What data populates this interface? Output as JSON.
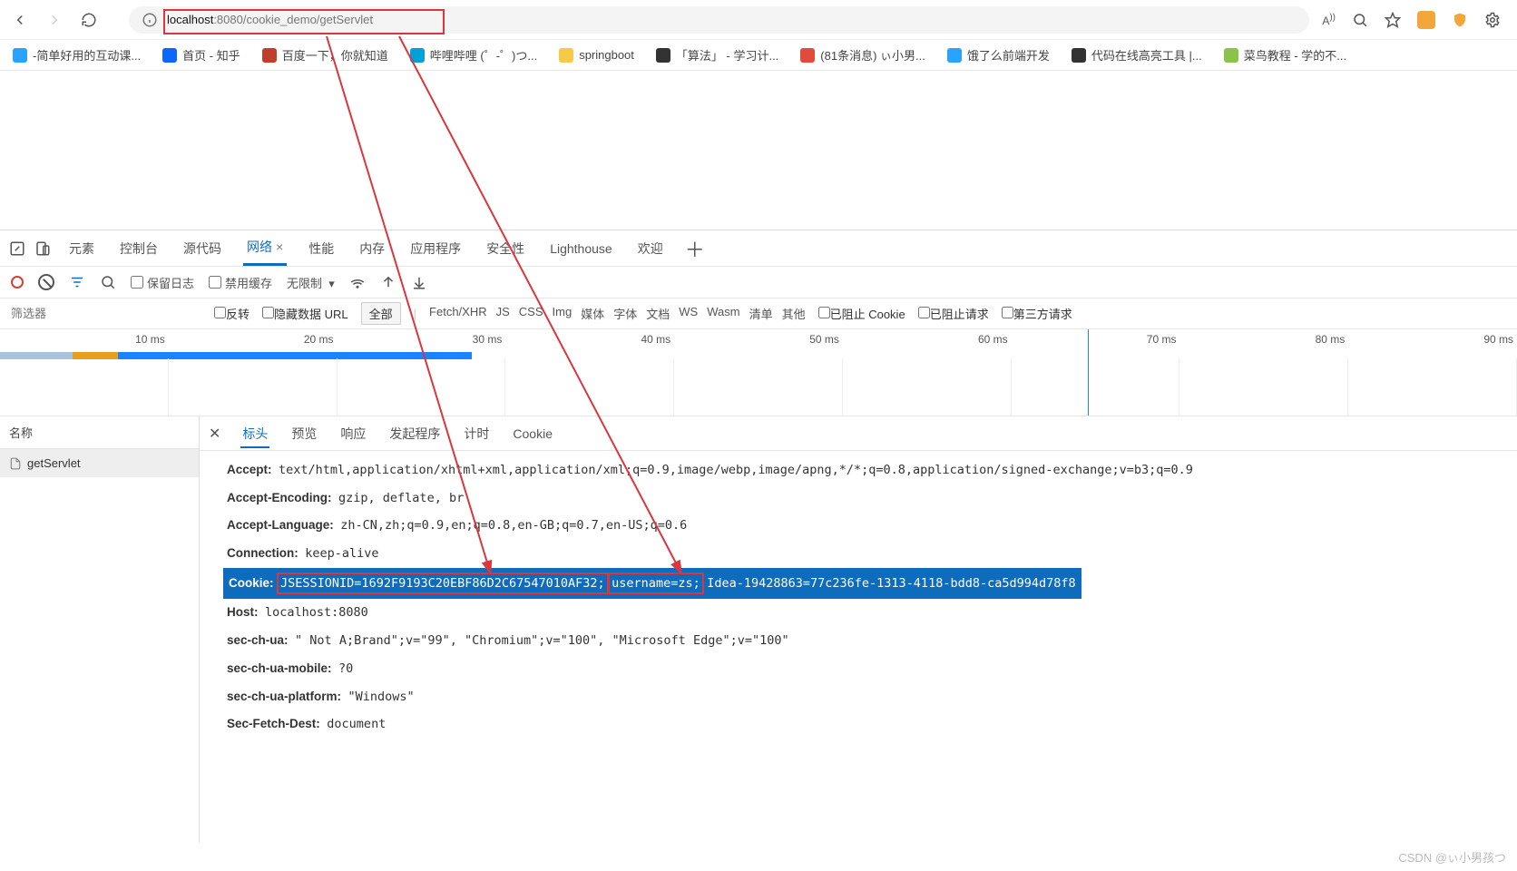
{
  "address_bar": {
    "host": "localhost",
    "port": ":8080",
    "path": "/cookie_demo/getServlet"
  },
  "bookmarks": [
    {
      "label": "-简单好用的互动课...",
      "color": "#2aa2ff"
    },
    {
      "label": "首页 - 知乎",
      "color": "#0a66ff"
    },
    {
      "label": "百度一下，你就知道",
      "color": "#c03f2b"
    },
    {
      "label": "哔哩哔哩 (゜-゜)つ...",
      "color": "#00a1d6"
    },
    {
      "label": "springboot",
      "color": "#f7c948"
    },
    {
      "label": "「算法」 - 学习计...",
      "color": "#333333"
    },
    {
      "label": "(81条消息) ぃ小男...",
      "color": "#e24a3b"
    },
    {
      "label": "饿了么前端开发",
      "color": "#2aa2ff"
    },
    {
      "label": "代码在线高亮工具 |...",
      "color": "#333333"
    },
    {
      "label": "菜鸟教程 - 学的不...",
      "color": "#8bc34a"
    }
  ],
  "devtools_tabs": [
    "元素",
    "控制台",
    "源代码",
    "网络",
    "性能",
    "内存",
    "应用程序",
    "安全性",
    "Lighthouse",
    "欢迎"
  ],
  "devtools_active": "网络",
  "toolbar": {
    "preserve_log": "保留日志",
    "disable_cache": "禁用缓存",
    "throttle": "无限制"
  },
  "filter": {
    "placeholder": "筛选器",
    "invert": "反转",
    "hide_data_url": "隐藏数据 URL",
    "all": "全部",
    "types": [
      "Fetch/XHR",
      "JS",
      "CSS",
      "Img",
      "媒体",
      "字体",
      "文档",
      "WS",
      "Wasm",
      "清单",
      "其他"
    ],
    "blocked_cookies": "已阻止 Cookie",
    "blocked_req": "已阻止请求",
    "third_party": "第三方请求"
  },
  "timeline_labels": [
    "10 ms",
    "20 ms",
    "30 ms",
    "40 ms",
    "50 ms",
    "60 ms",
    "70 ms",
    "80 ms",
    "90 ms"
  ],
  "names": {
    "header": "名称",
    "item": "getServlet"
  },
  "detail_tabs": [
    "标头",
    "预览",
    "响应",
    "发起程序",
    "计时",
    "Cookie"
  ],
  "detail_active": "标头",
  "headers": {
    "Accept": "text/html,application/xhtml+xml,application/xml;q=0.9,image/webp,image/apng,*/*;q=0.8,application/signed-exchange;v=b3;q=0.9",
    "Accept-Encoding": "gzip, deflate, br",
    "Accept-Language": "zh-CN,zh;q=0.9,en;q=0.8,en-GB;q=0.7,en-US;q=0.6",
    "Connection": "keep-alive",
    "Cookie": {
      "jsession": "JSESSIONID=1692F9193C20EBF86D2C67547010AF32;",
      "username": "username=zs;",
      "idea": "Idea-19428863=77c236fe-1313-4118-bdd8-ca5d994d78f8"
    },
    "Host": "localhost:8080",
    "sec-ch-ua": "\" Not A;Brand\";v=\"99\", \"Chromium\";v=\"100\", \"Microsoft Edge\";v=\"100\"",
    "sec-ch-ua-mobile": "?0",
    "sec-ch-ua-platform": "\"Windows\"",
    "Sec-Fetch-Dest": "document"
  },
  "watermark": "CSDN @ぃ小男孩つ"
}
